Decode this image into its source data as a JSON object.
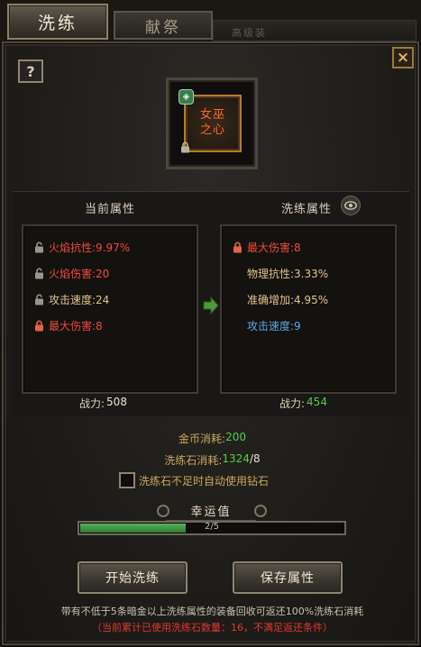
{
  "tabs": [
    {
      "label": "洗练",
      "active": true
    },
    {
      "label": "献祭",
      "active": false
    }
  ],
  "background_tab_text": "高级装",
  "help_label": "?",
  "close_label": "×",
  "item": {
    "name": "女巫\n之心",
    "badge_icon": "gem-badge-icon",
    "name_color": "#ff6a2a"
  },
  "current": {
    "title": "当前属性",
    "attributes": [
      {
        "text": "火焰抗性:9.97%",
        "color": "#ee4a3a",
        "locked": false
      },
      {
        "text": "火焰伤害:20",
        "color": "#ee4a3a",
        "locked": false
      },
      {
        "text": "攻击速度:24",
        "color": "#e0c48a",
        "locked": false
      },
      {
        "text": "最大伤害:8",
        "color": "#ee4a3a",
        "locked": true
      }
    ],
    "power_label": "战力:",
    "power_value": "508"
  },
  "refined": {
    "title": "洗练属性",
    "attributes": [
      {
        "text": "最大伤害:8",
        "color": "#ee4a3a",
        "locked": true
      },
      {
        "text": "物理抗性:3.33%",
        "color": "#e0c48a",
        "locked": null
      },
      {
        "text": "准确增加:4.95%",
        "color": "#e0c48a",
        "locked": null
      },
      {
        "text": "攻击速度:9",
        "color": "#5aa8e6",
        "locked": null
      }
    ],
    "power_label": "战力:",
    "power_value": "454"
  },
  "costs": {
    "gold_label": "金币消耗:",
    "gold_value": "200",
    "stone_label": "洗练石消耗:",
    "stone_have": "1324",
    "stone_need": "/8"
  },
  "auto_diamond_label": "洗练石不足时自动使用钻石",
  "luck": {
    "title": "幸运值",
    "current": 2,
    "max": 5,
    "text": "2/5"
  },
  "buttons": {
    "start": "开始洗练",
    "save": "保存属性"
  },
  "notes": {
    "recycle": "带有不低于5条暗金以上洗练属性的装备回收可返还100%洗练石消耗",
    "status": "（当前累计已使用洗练石数量：16，不满足返还条件）"
  },
  "colors": {
    "red": "#ee4a3a",
    "yellow": "#e0c48a",
    "blue": "#5aa8e6",
    "green": "#4fcf4a",
    "gold_label": "#c8a85a"
  }
}
